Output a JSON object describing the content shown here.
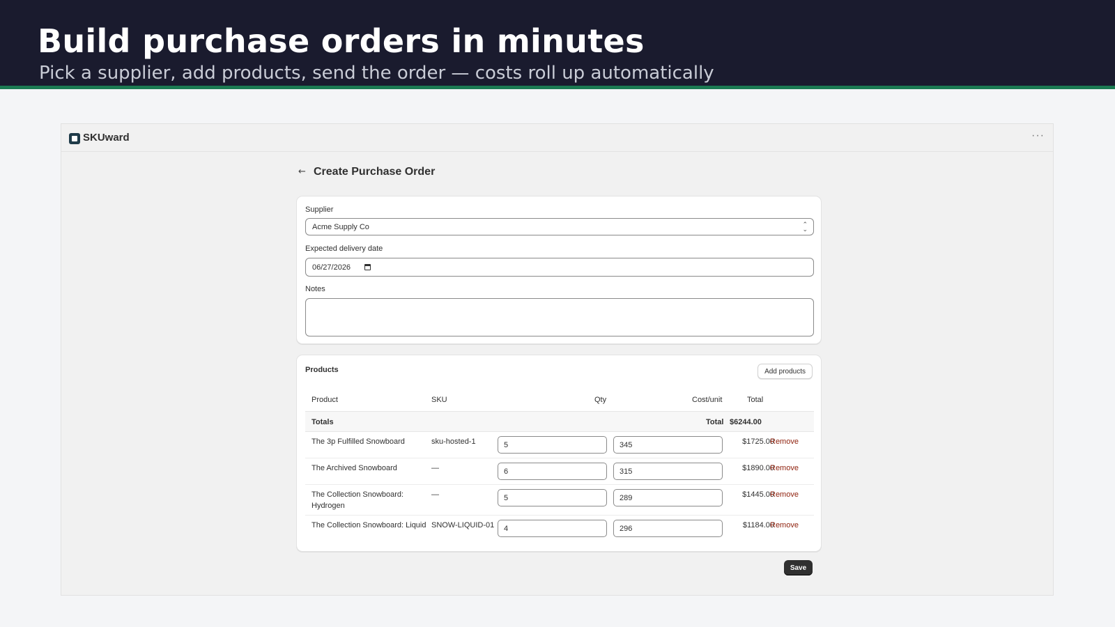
{
  "hero": {
    "title": "Build purchase orders in minutes",
    "subtitle": "Pick a supplier, add products, send the order — costs roll up automatically"
  },
  "app": {
    "brand": "SKUward",
    "more_label": "···",
    "back_label": "←",
    "page_title": "Create Purchase Order"
  },
  "form": {
    "supplier_label": "Supplier",
    "supplier_value": "Acme Supply Co",
    "date_label": "Expected delivery date",
    "date_value": "06/27/2026",
    "notes_label": "Notes",
    "notes_value": ""
  },
  "products": {
    "title": "Products",
    "add_label": "Add products",
    "columns": {
      "product": "Product",
      "sku": "SKU",
      "qty": "Qty",
      "cost": "Cost/unit",
      "total": "Total"
    },
    "totals": {
      "label": "Totals",
      "total_label": "Total",
      "total_value": "$6244.00"
    },
    "remove_label": "Remove",
    "rows": [
      {
        "name": "The 3p Fulfilled Snowboard",
        "sku": "sku-hosted-1",
        "qty": "5",
        "cost": "345",
        "total": "$1725.00"
      },
      {
        "name": "The Archived Snowboard",
        "sku": "—",
        "qty": "6",
        "cost": "315",
        "total": "$1890.00"
      },
      {
        "name": "The Collection Snowboard: Hydrogen",
        "sku": "—",
        "qty": "5",
        "cost": "289",
        "total": "$1445.00"
      },
      {
        "name": "The Collection Snowboard: Liquid",
        "sku": "SNOW-LIQUID-01",
        "qty": "4",
        "cost": "296",
        "total": "$1184.00"
      }
    ]
  },
  "save_label": "Save",
  "colors": {
    "hero_bg": "#1a1b2e",
    "hero_accent": "#1b7a52",
    "remove": "#8e1f0b",
    "primary_button": "#303030"
  }
}
